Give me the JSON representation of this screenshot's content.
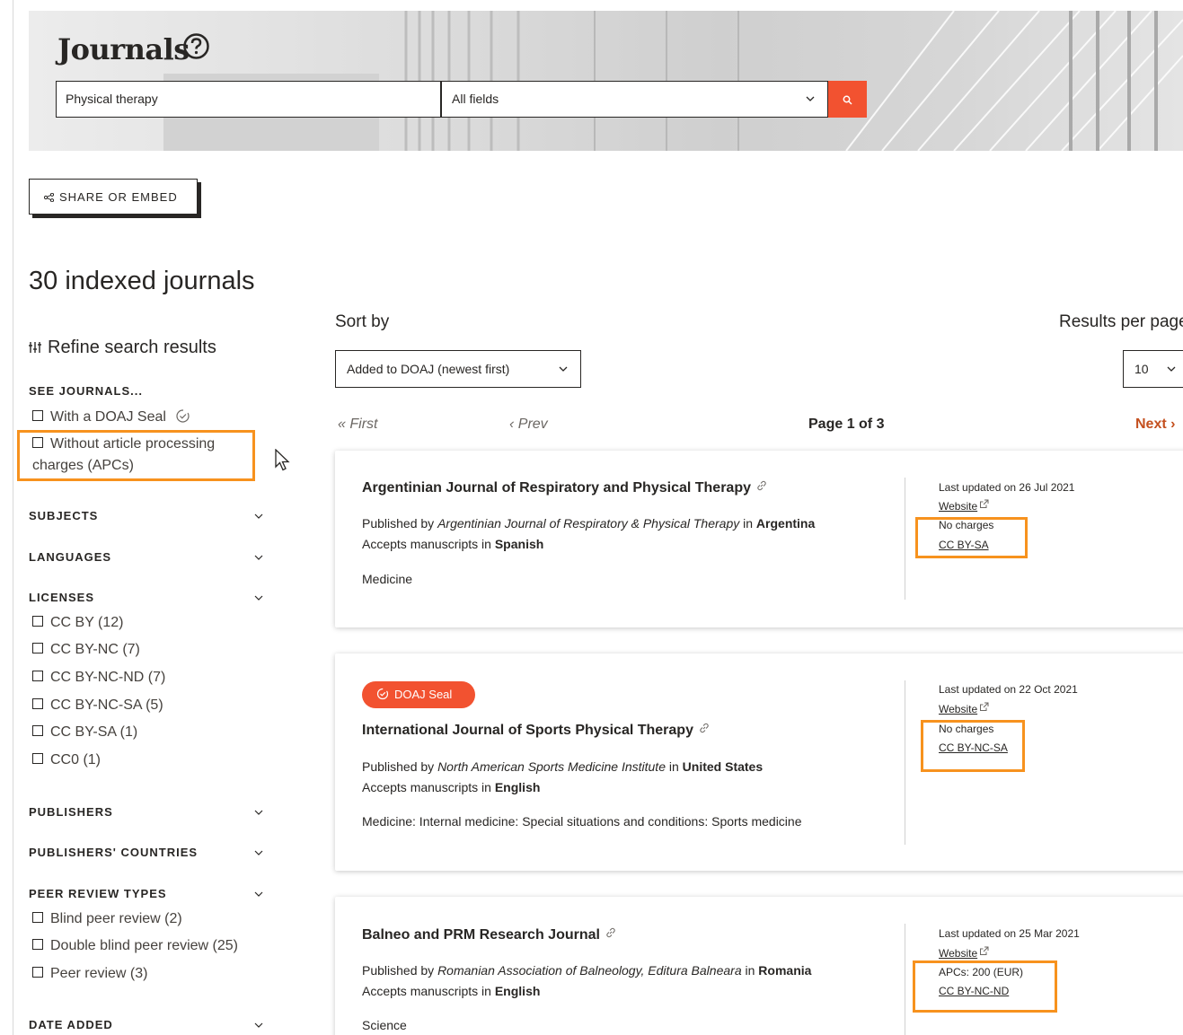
{
  "header": {
    "title": "Journals",
    "search_value": "Physical therapy",
    "field_select_value": "All fields"
  },
  "share_label": "SHARE OR EMBED",
  "results_title": "30 indexed journals",
  "sidebar": {
    "refine_label": "Refine search results",
    "see_journals_heading": "SEE JOURNALS...",
    "see_journals_options": [
      "With a DOAJ Seal",
      "Without article processing charges (APCs)"
    ],
    "subjects_heading": "SUBJECTS",
    "languages_heading": "LANGUAGES",
    "licenses_heading": "LICENSES",
    "license_options": [
      "CC BY (12)",
      "CC BY-NC (7)",
      "CC BY-NC-ND (7)",
      "CC BY-NC-SA (5)",
      "CC BY-SA (1)",
      "CC0 (1)"
    ],
    "publishers_heading": "PUBLISHERS",
    "countries_heading": "PUBLISHERS' COUNTRIES",
    "peer_review_heading": "PEER REVIEW TYPES",
    "peer_review_options": [
      "Blind peer review (2)",
      "Double blind peer review (25)",
      "Peer review (3)"
    ],
    "date_added_heading": "DATE ADDED"
  },
  "controls": {
    "sort_label": "Sort by",
    "sort_value": "Added to DOAJ (newest first)",
    "rpp_label": "Results per page",
    "rpp_value": "10",
    "first": "First",
    "prev": "Prev",
    "page": "Page 1 of 3",
    "next": "Next"
  },
  "cards": [
    {
      "seal": "",
      "title": "Argentinian Journal of Respiratory and Physical Therapy",
      "published_by_prefix": "Published by ",
      "publisher": "Argentinian Journal of Respiratory & Physical Therapy",
      "in_word": " in ",
      "country": "Argentina",
      "accepts_prefix": "Accepts manuscripts in ",
      "language": "Spanish",
      "subject": "Medicine",
      "updated": "Last updated on 26 Jul 2021",
      "website": "Website",
      "charges": "No charges",
      "license": "CC BY-SA"
    },
    {
      "seal": "DOAJ Seal",
      "title": "International Journal of Sports Physical Therapy",
      "published_by_prefix": "Published by ",
      "publisher": "North American Sports Medicine Institute",
      "in_word": " in ",
      "country": "United States",
      "accepts_prefix": "Accepts manuscripts in ",
      "language": "English",
      "subject": "Medicine: Internal medicine: Special situations and conditions: Sports medicine",
      "updated": "Last updated on 22 Oct 2021",
      "website": "Website",
      "charges": "No charges",
      "license": "CC BY-NC-SA"
    },
    {
      "seal": "",
      "title": "Balneo and PRM Research Journal",
      "published_by_prefix": "Published by ",
      "publisher": "Romanian Association of Balneology, Editura Balneara",
      "in_word": " in ",
      "country": "Romania",
      "accepts_prefix": "Accepts manuscripts in ",
      "language": "English",
      "subject": "Science",
      "updated": "Last updated on 25 Mar 2021",
      "website": "Website",
      "charges": "APCs: 200 (EUR)",
      "license": "CC BY-NC-ND"
    }
  ],
  "colors": {
    "accent": "#f25230",
    "highlight": "#f7921e",
    "next_link": "#c4501f"
  }
}
